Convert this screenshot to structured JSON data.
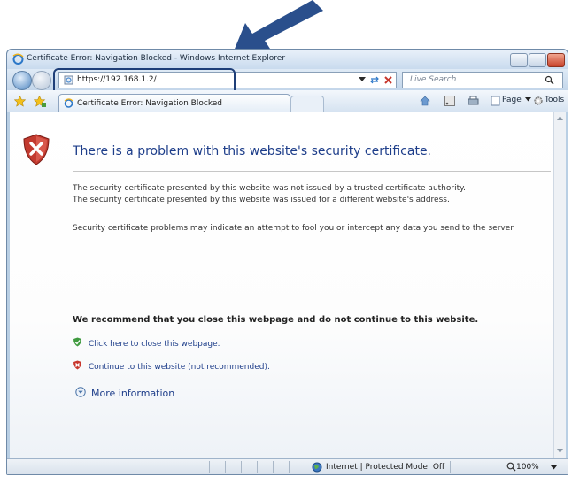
{
  "window": {
    "title": "Certificate Error: Navigation Blocked - Windows Internet Explorer"
  },
  "address_bar": {
    "url": "https://192.168.1.2/",
    "search_placeholder": "Live Search"
  },
  "tab": {
    "label": "Certificate Error: Navigation Blocked"
  },
  "command_bar": {
    "page_label": "Page",
    "tools_label": "Tools"
  },
  "content": {
    "heading": "There is a problem with this website's security certificate.",
    "para1_line1": "The security certificate presented by this website was not issued by a trusted certificate authority.",
    "para1_line2": "The security certificate presented by this website was issued for a different website's address.",
    "para2": "Security certificate problems may indicate an attempt to fool you or intercept any data you send to the server.",
    "recommend": "We recommend that you close this webpage and do not continue to this website.",
    "close_link": "Click here to close this webpage.",
    "continue_link": "Continue to this website (not recommended).",
    "more_info": "More information"
  },
  "status_bar": {
    "zone": "Internet | Protected Mode: Off",
    "zoom": "100%"
  },
  "colors": {
    "link": "#1e3e8a",
    "arrow": "#2a4f8c",
    "ok_green": "#3f9a3f",
    "error_red": "#c8372d"
  }
}
